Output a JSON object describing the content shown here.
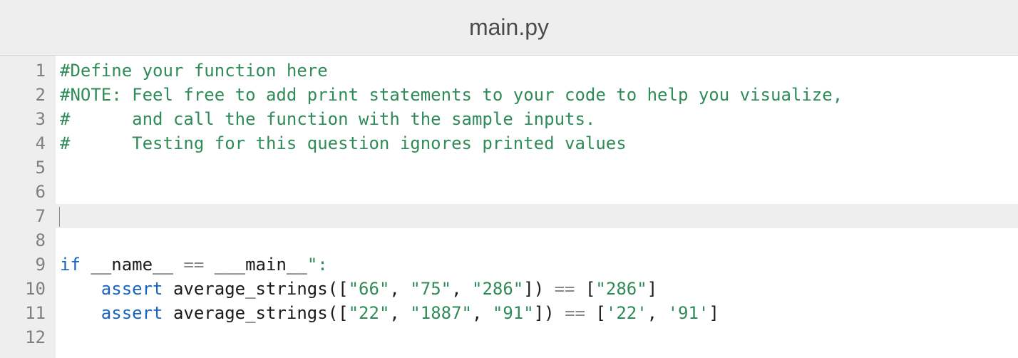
{
  "header": {
    "title": "main.py"
  },
  "editor": {
    "active_line": 7,
    "lines": [
      {
        "num": 1,
        "tokens": [
          {
            "cls": "tk-comment",
            "t": "#Define your function here"
          }
        ]
      },
      {
        "num": 2,
        "tokens": [
          {
            "cls": "tk-comment",
            "t": "#NOTE: Feel free to add print statements to your code to help you visualize,"
          }
        ]
      },
      {
        "num": 3,
        "tokens": [
          {
            "cls": "tk-comment",
            "t": "#      and call the function with the sample inputs."
          }
        ]
      },
      {
        "num": 4,
        "tokens": [
          {
            "cls": "tk-comment",
            "t": "#      Testing for this question ignores printed values"
          }
        ]
      },
      {
        "num": 5,
        "tokens": []
      },
      {
        "num": 6,
        "tokens": []
      },
      {
        "num": 7,
        "tokens": []
      },
      {
        "num": 8,
        "tokens": []
      },
      {
        "num": 9,
        "tokens": [
          {
            "cls": "tk-keyword",
            "t": "if"
          },
          {
            "cls": "tk-ident",
            "t": " __name__ "
          },
          {
            "cls": "tk-op",
            "t": "=="
          },
          {
            "cls": "tk-ident",
            "t": " ___main__"
          },
          {
            "cls": "tk-string",
            "t": "\":"
          }
        ]
      },
      {
        "num": 10,
        "tokens": [
          {
            "cls": "tk-ident",
            "t": "    "
          },
          {
            "cls": "tk-keyword",
            "t": "assert"
          },
          {
            "cls": "tk-ident",
            "t": " average_strings(["
          },
          {
            "cls": "tk-string",
            "t": "\"66\""
          },
          {
            "cls": "tk-ident",
            "t": ", "
          },
          {
            "cls": "tk-string",
            "t": "\"75\""
          },
          {
            "cls": "tk-ident",
            "t": ", "
          },
          {
            "cls": "tk-string",
            "t": "\"286\""
          },
          {
            "cls": "tk-ident",
            "t": "]) "
          },
          {
            "cls": "tk-op",
            "t": "=="
          },
          {
            "cls": "tk-ident",
            "t": " ["
          },
          {
            "cls": "tk-string",
            "t": "\"286\""
          },
          {
            "cls": "tk-ident",
            "t": "]"
          }
        ]
      },
      {
        "num": 11,
        "tokens": [
          {
            "cls": "tk-ident",
            "t": "    "
          },
          {
            "cls": "tk-keyword",
            "t": "assert"
          },
          {
            "cls": "tk-ident",
            "t": " average_strings(["
          },
          {
            "cls": "tk-string",
            "t": "\"22\""
          },
          {
            "cls": "tk-ident",
            "t": ", "
          },
          {
            "cls": "tk-string",
            "t": "\"1887\""
          },
          {
            "cls": "tk-ident",
            "t": ", "
          },
          {
            "cls": "tk-string",
            "t": "\"91\""
          },
          {
            "cls": "tk-ident",
            "t": "]) "
          },
          {
            "cls": "tk-op",
            "t": "=="
          },
          {
            "cls": "tk-ident",
            "t": " ["
          },
          {
            "cls": "tk-string",
            "t": "'22'"
          },
          {
            "cls": "tk-ident",
            "t": ", "
          },
          {
            "cls": "tk-string",
            "t": "'91'"
          },
          {
            "cls": "tk-ident",
            "t": "]"
          }
        ]
      },
      {
        "num": 12,
        "tokens": []
      }
    ]
  }
}
